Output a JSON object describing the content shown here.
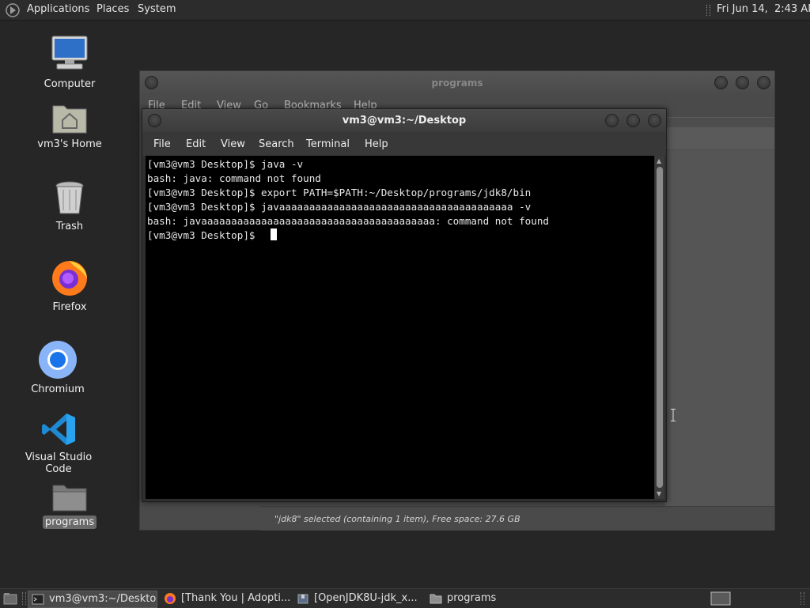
{
  "top_panel": {
    "menu": [
      "Applications",
      "Places",
      "System"
    ],
    "clock": "Fri Jun 14,  2:43 AM"
  },
  "desktop_icons": [
    {
      "label": "Computer",
      "icon": "computer-icon"
    },
    {
      "label": "vm3's Home",
      "icon": "home-folder-icon"
    },
    {
      "label": "Trash",
      "icon": "trash-icon"
    },
    {
      "label": "Firefox",
      "icon": "firefox-icon"
    },
    {
      "label": "Chromium",
      "icon": "chromium-icon"
    },
    {
      "label": "Visual Studio Code",
      "icon": "vscode-icon"
    },
    {
      "label": "programs",
      "icon": "folder-icon",
      "selected": true
    }
  ],
  "file_manager": {
    "title": "programs",
    "menu": [
      "File",
      "Edit",
      "View",
      "Go",
      "Bookmarks",
      "Help"
    ],
    "status": "\"jdk8\" selected (containing 1 item), Free space: 27.6 GB"
  },
  "terminal": {
    "title": "vm3@vm3:~/Desktop",
    "menu": [
      "File",
      "Edit",
      "View",
      "Search",
      "Terminal",
      "Help"
    ],
    "lines": [
      "[vm3@vm3 Desktop]$ java -v",
      "bash: java: command not found",
      "[vm3@vm3 Desktop]$ export PATH=$PATH:~/Desktop/programs/jdk8/bin",
      "[vm3@vm3 Desktop]$ javaaaaaaaaaaaaaaaaaaaaaaaaaaaaaaaaaaaaaaa -v",
      "bash: javaaaaaaaaaaaaaaaaaaaaaaaaaaaaaaaaaaaaaaa: command not found",
      "[vm3@vm3 Desktop]$ "
    ]
  },
  "taskbar": {
    "tasks": [
      {
        "label": "vm3@vm3:~/Desktop",
        "icon": "terminal-icon",
        "active": true
      },
      {
        "label": "[Thank You | Adopti...",
        "icon": "firefox-icon"
      },
      {
        "label": "[OpenJDK8U-jdk_x...",
        "icon": "archive-icon"
      },
      {
        "label": "programs",
        "icon": "folder-icon"
      }
    ]
  },
  "colors": {
    "desktop_bg": "#262626",
    "panel_bg": "#2c2c2c",
    "terminal_bg": "#000000"
  }
}
